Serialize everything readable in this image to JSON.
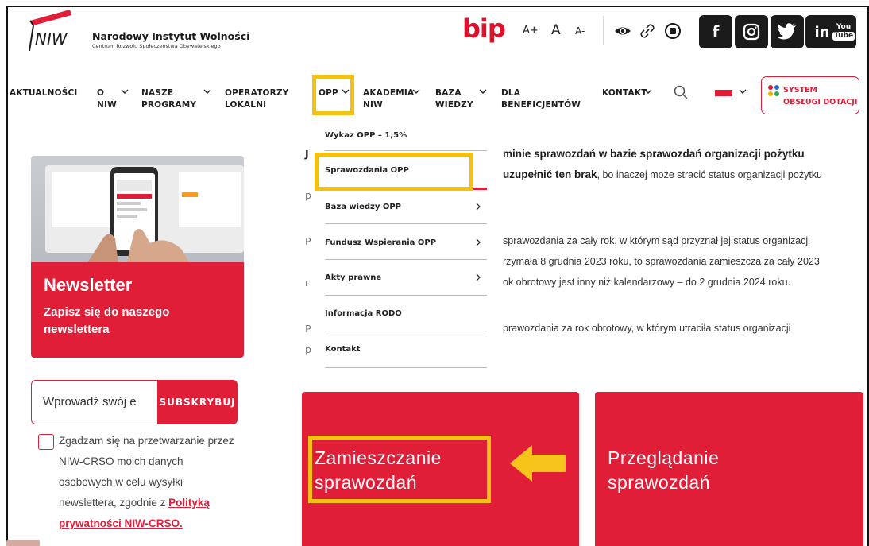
{
  "header": {
    "org_name": "Narodowy Instytut Wolności",
    "org_sub": "Centrum Rozwoju Społeczeństwa Obywatelskiego",
    "logo_text": "NIW",
    "bip": "bip",
    "font_increase": "A+",
    "font_normal": "A",
    "font_decrease": "A-",
    "social": [
      {
        "icon": "facebook-icon",
        "glyph": "f"
      },
      {
        "icon": "instagram-icon",
        "glyph": "◎"
      },
      {
        "icon": "twitter-icon",
        "glyph": "🐦"
      },
      {
        "icon": "linkedin-icon",
        "glyph": "in"
      },
      {
        "icon": "youtube-icon",
        "glyph": "You Tube"
      }
    ]
  },
  "nav": {
    "aktualnosci": "AKTUALNOŚCI",
    "o_niw_1": "O",
    "o_niw_2": "NIW",
    "nasze_1": "NASZE",
    "nasze_2": "PROGRAMY",
    "operatorzy_1": "OPERATORZY",
    "operatorzy_2": "LOKALNI",
    "opp": "OPP",
    "akademia_1": "AKADEMIA",
    "akademia_2": "NIW",
    "baza_1": "BAZA",
    "baza_2": "WIEDZY",
    "dla_1": "DLA",
    "dla_2": "BENEFICJENTÓW",
    "kontakt": "KONTAKT",
    "sod_1": "SYSTEM",
    "sod_2": "OBSŁUGI DOTACJI"
  },
  "dropdown": {
    "items": [
      {
        "label": "Wykaz OPP – 1,5%",
        "has_sub": false
      },
      {
        "label": "Sprawozdania OPP",
        "has_sub": false
      },
      {
        "label": "Baza wiedzy OPP",
        "has_sub": true
      },
      {
        "label": "Fundusz Wspierania OPP",
        "has_sub": true
      },
      {
        "label": "Akty prawne",
        "has_sub": true
      },
      {
        "label": "Informacja RODO",
        "has_sub": false
      },
      {
        "label": "Kontakt",
        "has_sub": false
      }
    ]
  },
  "newsletter": {
    "title": "Newsletter",
    "subtitle": "Zapisz się do naszego newslettera",
    "email_placeholder": "Wprowadź swój e",
    "subscribe": "SUBSKRYBUJ",
    "consent_text": "Zgadzam się na przetwarzanie przez NIW-CRSO moich danych osobowych w celu wysyłki newslettera, zgodnie z ",
    "consent_link": "Polityką prywatności NIW-CRSO."
  },
  "content": {
    "line1_bold": "minie sprawozdań w bazie sprawozdań organizacji pożytku",
    "line2_bold": "uzupełnić ten brak",
    "line2_rest": ", bo inaczej może stracić status organizacji pożytku",
    "line3": "sprawozdania za cały rok, w którym sąd przyznał jej status organizacji",
    "line4": "rzymała 8 grudnia 2023 roku, to sprawozdania zamieszcza za cały 2023",
    "line5": "ok obrotowy jest inny niż kalendarzowy – do 2 grudnia 2024 roku.",
    "line6": "prawozdania za rok obrotowy, w którym utraciła status organizacji",
    "frag_j": "J",
    "frag_p": "p",
    "frag_P": "P",
    "frag_r": "r"
  },
  "tiles": {
    "left_1": "Zamieszczanie",
    "left_2": "sprawozdań",
    "right_1": "Przeglądanie",
    "right_2": "sprawozdań"
  },
  "colors": {
    "brand_red": "#e01e38",
    "highlight_yellow": "#f4c112",
    "arrow_yellow": "#f6c41b"
  }
}
